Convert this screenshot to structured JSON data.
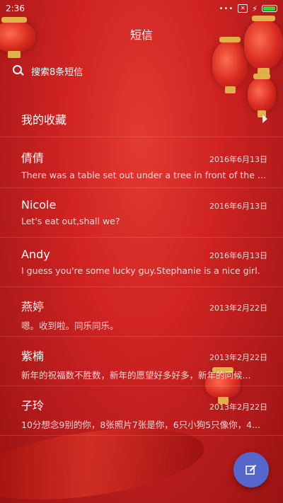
{
  "status_bar": {
    "time": "2:36"
  },
  "header": {
    "title": "短信"
  },
  "search": {
    "placeholder": "搜索8条短信"
  },
  "favorites": {
    "label": "我的收藏"
  },
  "messages": [
    {
      "name": "倩倩",
      "date": "2016年6月13日",
      "preview": "There was a table set out under a tree in front of the ho..."
    },
    {
      "name": "Nicole",
      "date": "2016年6月13日",
      "preview": "Let's eat out,shall we?"
    },
    {
      "name": "Andy",
      "date": "2016年6月13日",
      "preview": "I guess you're some lucky guy.Stephanie is a nice girl."
    },
    {
      "name": "燕婷",
      "date": "2013年2月22日",
      "preview": "嗯。收到啦。同乐同乐。"
    },
    {
      "name": "紫楠",
      "date": "2013年2月22日",
      "preview": "新年的祝福数不胜数，新年的愿望好多好多，新年的问候..."
    },
    {
      "name": "子玲",
      "date": "2013年2月22日",
      "preview": "10分想念9别的你，8张照片7张是你，6只小狗5只像你，4..."
    }
  ],
  "colors": {
    "background": "#cf2222",
    "fab": "#5566cc",
    "battery": "#37d33b"
  }
}
